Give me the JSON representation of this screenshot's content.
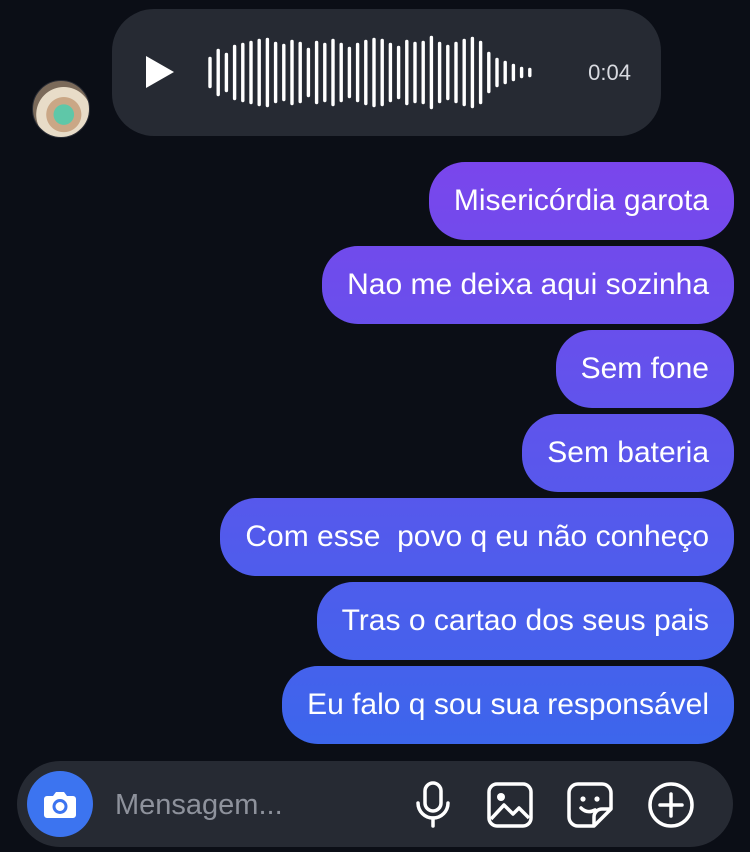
{
  "incoming": {
    "voice_message": {
      "duration": "0:04",
      "bars": [
        28,
        44,
        36,
        52,
        56,
        60,
        64,
        66,
        58,
        54,
        62,
        58,
        46,
        60,
        56,
        64,
        56,
        48,
        56,
        62,
        66,
        64,
        56,
        50,
        62,
        58,
        60,
        70,
        58,
        52,
        58,
        64,
        68,
        60,
        38,
        26,
        20,
        14,
        8,
        6
      ]
    }
  },
  "outgoing_messages": [
    "Misericórdia garota",
    "Nao me deixa aqui sozinha",
    "Sem fone",
    "Sem bateria",
    "Com esse  povo q eu não conheço",
    "Tras o cartao dos seus pais",
    "Eu falo q sou sua responsável"
  ],
  "colors": {
    "gradient_top": "#7a46ec",
    "gradient_bottom": "#3c66ec",
    "camera": "#3c74f0"
  },
  "composer": {
    "placeholder": "Mensagem...",
    "icons": [
      "camera-icon",
      "microphone-icon",
      "image-icon",
      "sticker-icon",
      "plus-icon"
    ]
  }
}
